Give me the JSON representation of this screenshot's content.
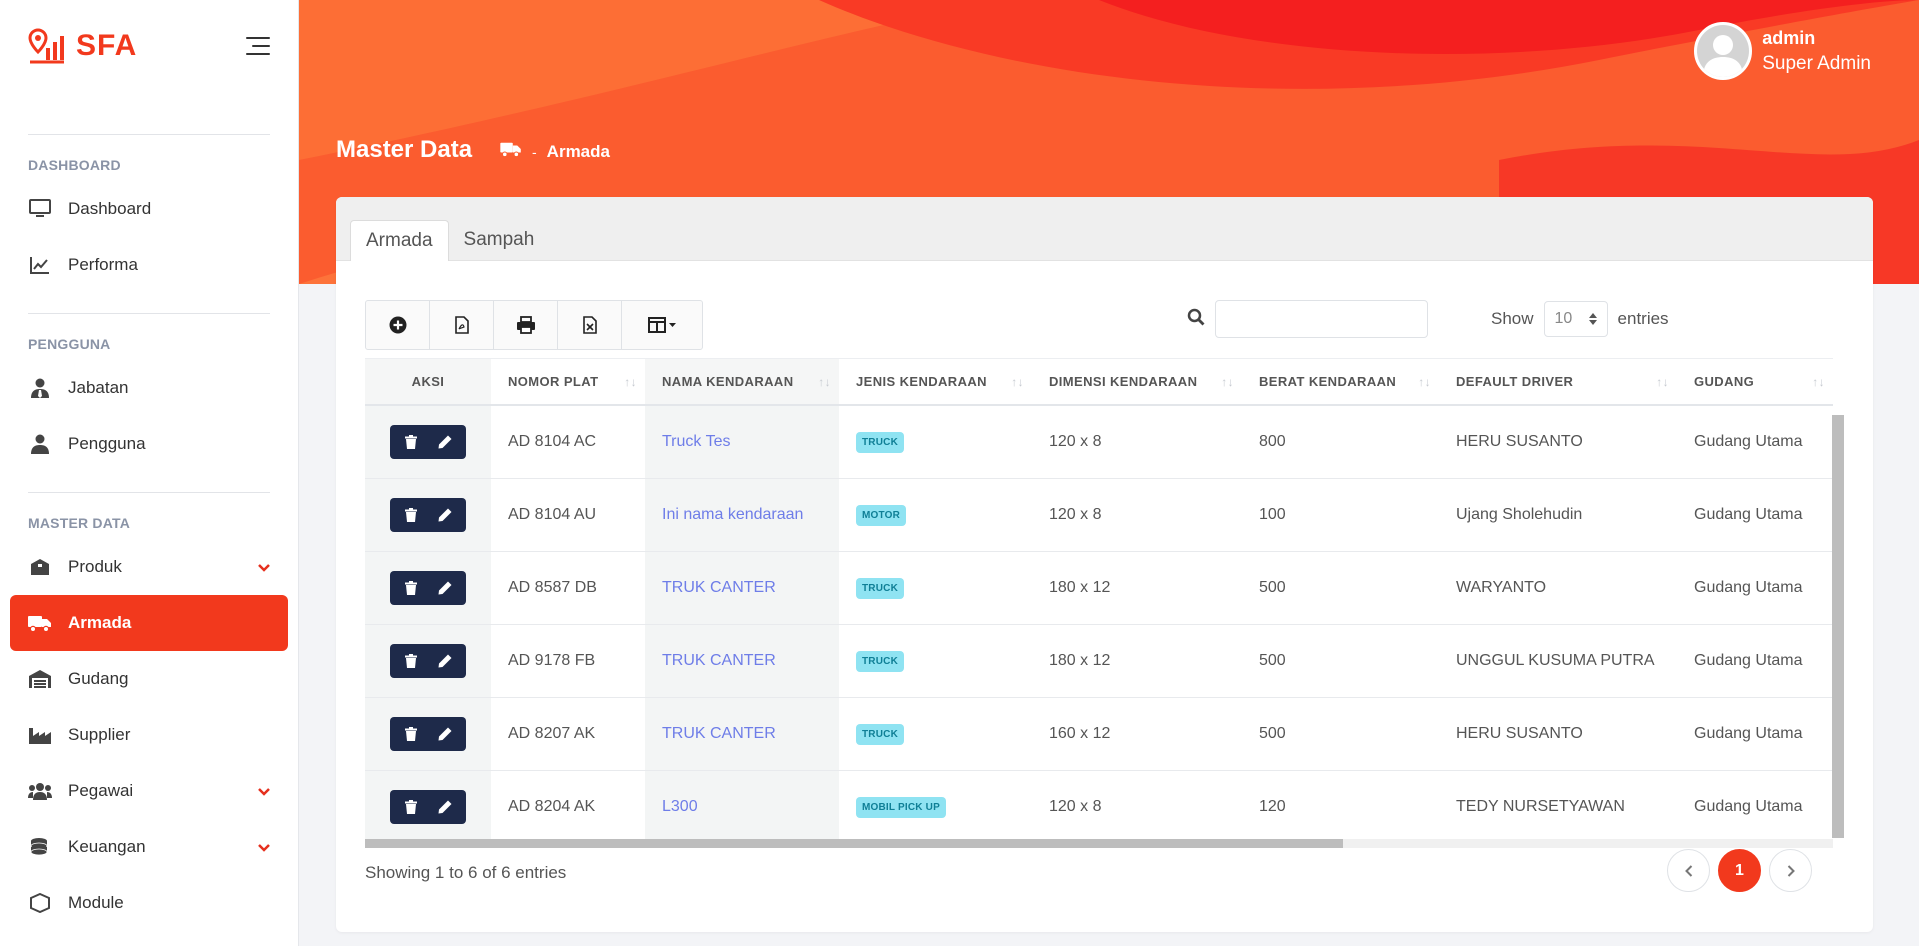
{
  "app": {
    "logo_text": "SFA"
  },
  "user": {
    "name": "admin",
    "role": "Super Admin"
  },
  "page": {
    "title": "Master Data",
    "breadcrumb": "Armada",
    "breadcrumb_sep": "-"
  },
  "sidebar": {
    "sections": {
      "dashboard": "DASHBOARD",
      "pengguna": "PENGGUNA",
      "master": "MASTER DATA"
    },
    "items": {
      "dashboard": "Dashboard",
      "performa": "Performa",
      "jabatan": "Jabatan",
      "pengguna": "Pengguna",
      "produk": "Produk",
      "armada": "Armada",
      "gudang": "Gudang",
      "supplier": "Supplier",
      "pegawai": "Pegawai",
      "keuangan": "Keuangan",
      "module": "Module"
    }
  },
  "tabs": {
    "armada": "Armada",
    "sampah": "Sampah"
  },
  "controls": {
    "show_label": "Show",
    "entries_label": "entries",
    "page_size": "10",
    "search_value": ""
  },
  "table": {
    "columns": {
      "aksi": "AKSI",
      "plat": "NOMOR PLAT",
      "nama": "NAMA KENDARAAN",
      "jenis": "JENIS KENDARAAN",
      "dimensi": "DIMENSI KENDARAAN",
      "berat": "BERAT KENDARAAN",
      "driver": "DEFAULT DRIVER",
      "gudang": "GUDANG"
    },
    "rows": [
      {
        "plat": "AD 8104 AC",
        "nama": "Truck Tes",
        "jenis": "TRUCK",
        "dimensi": "120 x 8",
        "berat": "800",
        "driver": "HERU SUSANTO",
        "gudang": "Gudang Utama"
      },
      {
        "plat": "AD 8104 AU",
        "nama": "Ini nama kendaraan",
        "jenis": "MOTOR",
        "dimensi": "120 x 8",
        "berat": "100",
        "driver": "Ujang Sholehudin",
        "gudang": "Gudang Utama"
      },
      {
        "plat": "AD 8587 DB",
        "nama": "TRUK CANTER",
        "jenis": "TRUCK",
        "dimensi": "180 x 12",
        "berat": "500",
        "driver": "WARYANTO",
        "gudang": "Gudang Utama"
      },
      {
        "plat": "AD 9178 FB",
        "nama": "TRUK CANTER",
        "jenis": "TRUCK",
        "dimensi": "180 x 12",
        "berat": "500",
        "driver": "UNGGUL KUSUMA PUTRA",
        "gudang": "Gudang Utama"
      },
      {
        "plat": "AD 8207 AK",
        "nama": "TRUK CANTER",
        "jenis": "TRUCK",
        "dimensi": "160 x 12",
        "berat": "500",
        "driver": "HERU SUSANTO",
        "gudang": "Gudang Utama"
      },
      {
        "plat": "AD 8204 AK",
        "nama": "L300",
        "jenis": "MOBIL PICK UP",
        "dimensi": "120 x 8",
        "berat": "120",
        "driver": "TEDY NURSETYAWAN",
        "gudang": "Gudang Utama"
      }
    ]
  },
  "footer": {
    "info": "Showing 1 to 6 of 6 entries",
    "current_page": "1"
  },
  "colors": {
    "accent": "#f2391d",
    "dark_action": "#1e2a4a",
    "badge_bg": "#8fe3f2",
    "link": "#6e7de8"
  }
}
